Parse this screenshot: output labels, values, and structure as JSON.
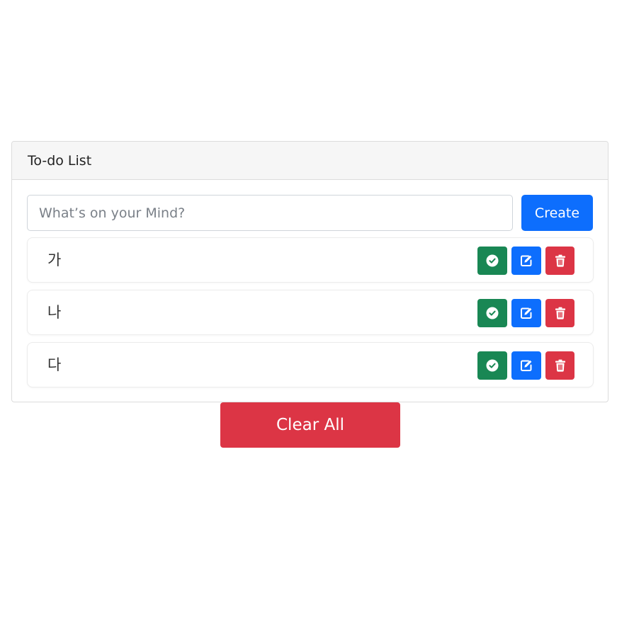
{
  "card": {
    "title": "To-do List"
  },
  "input": {
    "placeholder": "What’s on your Mind?",
    "value": ""
  },
  "create_label": "Create",
  "todos": [
    {
      "text": "가"
    },
    {
      "text": "나"
    },
    {
      "text": "다"
    }
  ],
  "icons": {
    "done": "check-circle-icon",
    "edit": "edit-icon",
    "delete": "trash-icon"
  },
  "clear_label": "Clear All",
  "colors": {
    "primary": "#0d6efd",
    "success": "#198754",
    "danger": "#dc3545"
  }
}
